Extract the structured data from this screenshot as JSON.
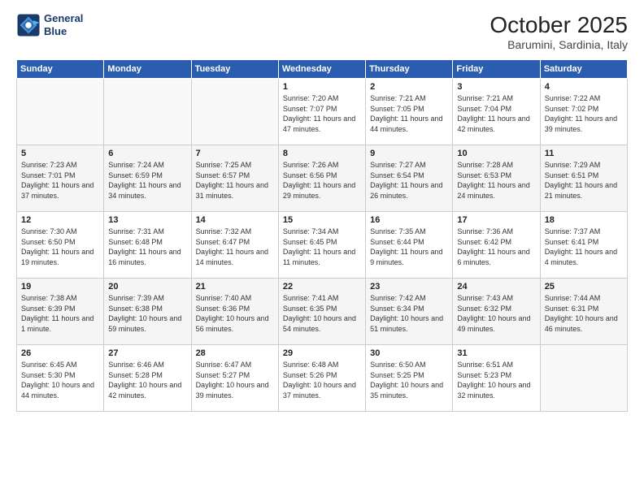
{
  "header": {
    "logo_line1": "General",
    "logo_line2": "Blue",
    "month": "October 2025",
    "location": "Barumini, Sardinia, Italy"
  },
  "weekdays": [
    "Sunday",
    "Monday",
    "Tuesday",
    "Wednesday",
    "Thursday",
    "Friday",
    "Saturday"
  ],
  "weeks": [
    [
      {
        "day": "",
        "text": ""
      },
      {
        "day": "",
        "text": ""
      },
      {
        "day": "",
        "text": ""
      },
      {
        "day": "1",
        "text": "Sunrise: 7:20 AM\nSunset: 7:07 PM\nDaylight: 11 hours and 47 minutes."
      },
      {
        "day": "2",
        "text": "Sunrise: 7:21 AM\nSunset: 7:05 PM\nDaylight: 11 hours and 44 minutes."
      },
      {
        "day": "3",
        "text": "Sunrise: 7:21 AM\nSunset: 7:04 PM\nDaylight: 11 hours and 42 minutes."
      },
      {
        "day": "4",
        "text": "Sunrise: 7:22 AM\nSunset: 7:02 PM\nDaylight: 11 hours and 39 minutes."
      }
    ],
    [
      {
        "day": "5",
        "text": "Sunrise: 7:23 AM\nSunset: 7:01 PM\nDaylight: 11 hours and 37 minutes."
      },
      {
        "day": "6",
        "text": "Sunrise: 7:24 AM\nSunset: 6:59 PM\nDaylight: 11 hours and 34 minutes."
      },
      {
        "day": "7",
        "text": "Sunrise: 7:25 AM\nSunset: 6:57 PM\nDaylight: 11 hours and 31 minutes."
      },
      {
        "day": "8",
        "text": "Sunrise: 7:26 AM\nSunset: 6:56 PM\nDaylight: 11 hours and 29 minutes."
      },
      {
        "day": "9",
        "text": "Sunrise: 7:27 AM\nSunset: 6:54 PM\nDaylight: 11 hours and 26 minutes."
      },
      {
        "day": "10",
        "text": "Sunrise: 7:28 AM\nSunset: 6:53 PM\nDaylight: 11 hours and 24 minutes."
      },
      {
        "day": "11",
        "text": "Sunrise: 7:29 AM\nSunset: 6:51 PM\nDaylight: 11 hours and 21 minutes."
      }
    ],
    [
      {
        "day": "12",
        "text": "Sunrise: 7:30 AM\nSunset: 6:50 PM\nDaylight: 11 hours and 19 minutes."
      },
      {
        "day": "13",
        "text": "Sunrise: 7:31 AM\nSunset: 6:48 PM\nDaylight: 11 hours and 16 minutes."
      },
      {
        "day": "14",
        "text": "Sunrise: 7:32 AM\nSunset: 6:47 PM\nDaylight: 11 hours and 14 minutes."
      },
      {
        "day": "15",
        "text": "Sunrise: 7:34 AM\nSunset: 6:45 PM\nDaylight: 11 hours and 11 minutes."
      },
      {
        "day": "16",
        "text": "Sunrise: 7:35 AM\nSunset: 6:44 PM\nDaylight: 11 hours and 9 minutes."
      },
      {
        "day": "17",
        "text": "Sunrise: 7:36 AM\nSunset: 6:42 PM\nDaylight: 11 hours and 6 minutes."
      },
      {
        "day": "18",
        "text": "Sunrise: 7:37 AM\nSunset: 6:41 PM\nDaylight: 11 hours and 4 minutes."
      }
    ],
    [
      {
        "day": "19",
        "text": "Sunrise: 7:38 AM\nSunset: 6:39 PM\nDaylight: 11 hours and 1 minute."
      },
      {
        "day": "20",
        "text": "Sunrise: 7:39 AM\nSunset: 6:38 PM\nDaylight: 10 hours and 59 minutes."
      },
      {
        "day": "21",
        "text": "Sunrise: 7:40 AM\nSunset: 6:36 PM\nDaylight: 10 hours and 56 minutes."
      },
      {
        "day": "22",
        "text": "Sunrise: 7:41 AM\nSunset: 6:35 PM\nDaylight: 10 hours and 54 minutes."
      },
      {
        "day": "23",
        "text": "Sunrise: 7:42 AM\nSunset: 6:34 PM\nDaylight: 10 hours and 51 minutes."
      },
      {
        "day": "24",
        "text": "Sunrise: 7:43 AM\nSunset: 6:32 PM\nDaylight: 10 hours and 49 minutes."
      },
      {
        "day": "25",
        "text": "Sunrise: 7:44 AM\nSunset: 6:31 PM\nDaylight: 10 hours and 46 minutes."
      }
    ],
    [
      {
        "day": "26",
        "text": "Sunrise: 6:45 AM\nSunset: 5:30 PM\nDaylight: 10 hours and 44 minutes."
      },
      {
        "day": "27",
        "text": "Sunrise: 6:46 AM\nSunset: 5:28 PM\nDaylight: 10 hours and 42 minutes."
      },
      {
        "day": "28",
        "text": "Sunrise: 6:47 AM\nSunset: 5:27 PM\nDaylight: 10 hours and 39 minutes."
      },
      {
        "day": "29",
        "text": "Sunrise: 6:48 AM\nSunset: 5:26 PM\nDaylight: 10 hours and 37 minutes."
      },
      {
        "day": "30",
        "text": "Sunrise: 6:50 AM\nSunset: 5:25 PM\nDaylight: 10 hours and 35 minutes."
      },
      {
        "day": "31",
        "text": "Sunrise: 6:51 AM\nSunset: 5:23 PM\nDaylight: 10 hours and 32 minutes."
      },
      {
        "day": "",
        "text": ""
      }
    ]
  ]
}
